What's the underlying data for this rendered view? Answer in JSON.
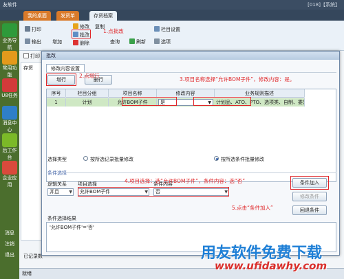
{
  "app": {
    "title": "友软件",
    "right_info": "[018]【系统】"
  },
  "top_tabs": [
    "我的桌面",
    "发货单",
    "存货档案"
  ],
  "left_nav": [
    "业务导航",
    "常用功能",
    "U8任务",
    "消息中心",
    "后工作台",
    "企业应用"
  ],
  "left_nav_bottom": [
    "消息",
    "注销",
    "退出"
  ],
  "ribbon": {
    "print": "打印",
    "output": "输出",
    "add": "增加",
    "modify": "修改",
    "batch_change": "批改",
    "delete": "删除",
    "copy": "复制",
    "query": "查询",
    "refresh": "刷新",
    "column_settings": "栏目设置",
    "options": "选项",
    "print_preview": "打印"
  },
  "bg": {
    "tree_node": "存货",
    "status": "已记录数",
    "footer": "就绪"
  },
  "dialog": {
    "title": "批改",
    "inner_tab": "修改内容设置",
    "add_row": "增行",
    "delete_row": "删行",
    "columns": [
      "序号",
      "栏目分组",
      "项目名称",
      "修改内容",
      "业务规则描述"
    ],
    "row": {
      "seq": "1",
      "group": "计划",
      "item": "允许BOM子件",
      "value": "是",
      "rule": "计划品、ATO、PTO、选项类、自制、委外件、"
    },
    "condition_type_label": "选择类型",
    "radio_records": "按所选记录批量修改",
    "radio_conditions": "按所选条件批量修改",
    "condition_section": "条件选择",
    "logic_label": "逻辑关系",
    "item_select_label": "项目选择",
    "condition_content_label": "条件内容",
    "logic_value": "并且",
    "item_value": "允许BOM子件",
    "condition_value": "否",
    "btn_add_condition": "条件加入",
    "btn_modify_condition": "修改条件",
    "btn_remove_condition": "回退条件",
    "result_label": "条件选择结果",
    "result_text": "'允许BOM子件'='否'"
  },
  "annotations": {
    "a1": "1.点批改",
    "a2": "2.点增行",
    "a3": "3.项目名称选择“允许BOM子件”，修改内容：是。",
    "a4": "4.项目选择：选“允许BOM子件”，条件内容：选“否”",
    "a5": "5.点击“条件加入”"
  },
  "watermark": {
    "cn": "用友软件免费下载",
    "url": "www.ufidawhy.com"
  },
  "colors": {
    "accent_red": "#e0272a",
    "row_green": "#cfe8c4",
    "nav_green": "#4b6e2d",
    "watermark_blue": "#1e7fd6"
  }
}
